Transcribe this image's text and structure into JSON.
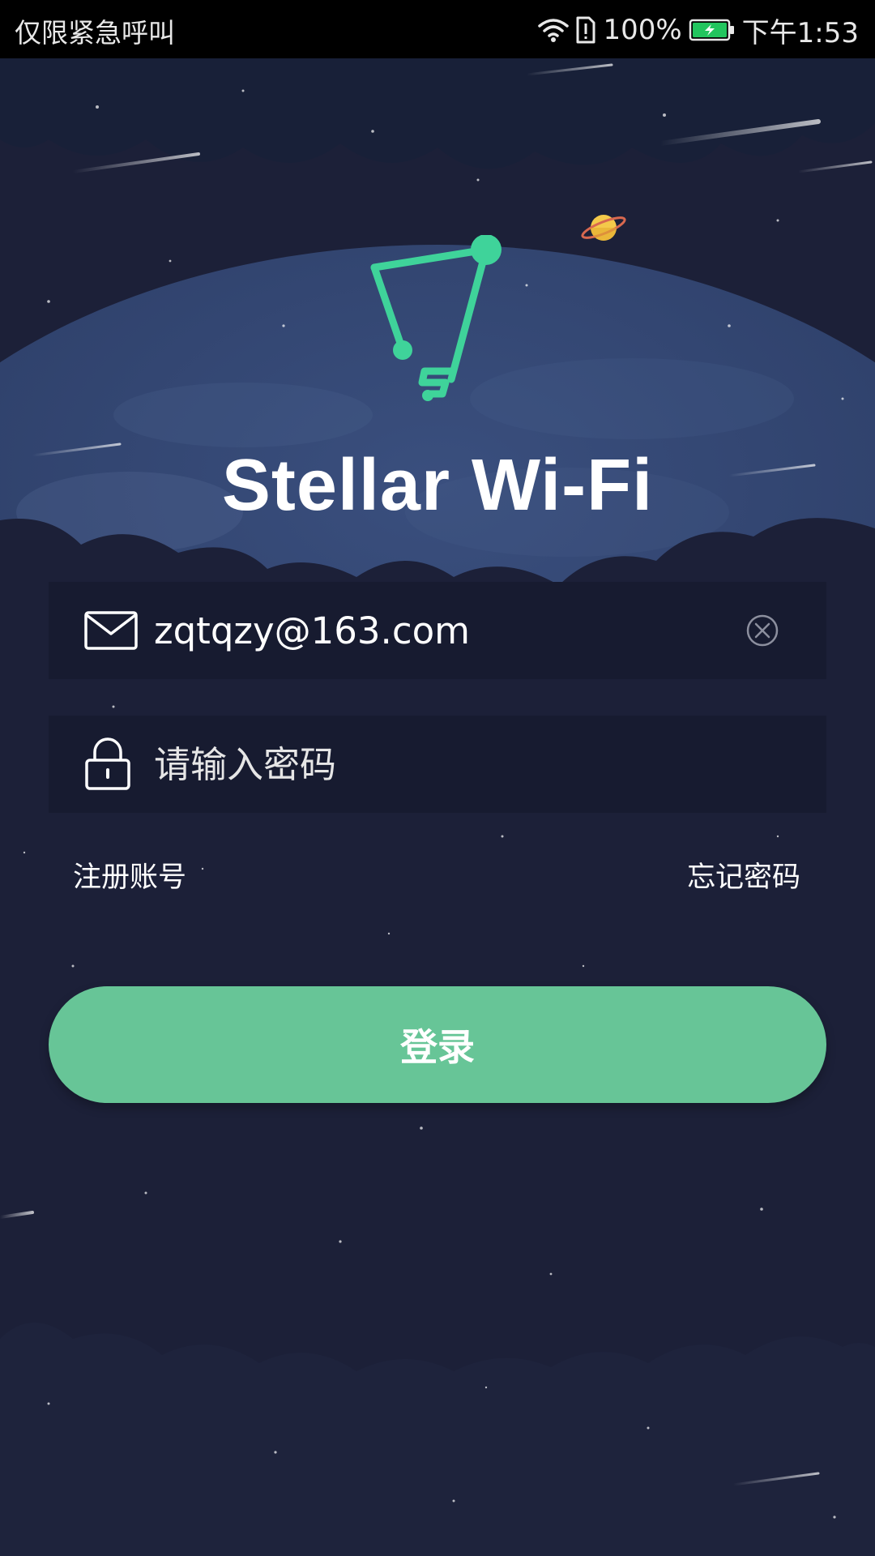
{
  "status_bar": {
    "carrier_text": "仅限紧急呼叫",
    "battery_percent": "100%",
    "time": "下午1:53",
    "icons": [
      "wifi-icon",
      "sim-alert-icon",
      "battery-charging-icon"
    ],
    "battery_color": "#22c55e"
  },
  "app": {
    "title": "Stellar Wi-Fi",
    "logo_icon": "constellation-logo-icon",
    "accent_color": "#67c597"
  },
  "login_form": {
    "email": {
      "icon": "mail-icon",
      "value": "zqtqzy@163.com",
      "clear_icon": "clear-circle-x-icon"
    },
    "password": {
      "icon": "lock-icon",
      "value": "",
      "placeholder": "请输入密码"
    },
    "register_label": "注册账号",
    "forgot_label": "忘记密码",
    "login_label": "登录"
  }
}
